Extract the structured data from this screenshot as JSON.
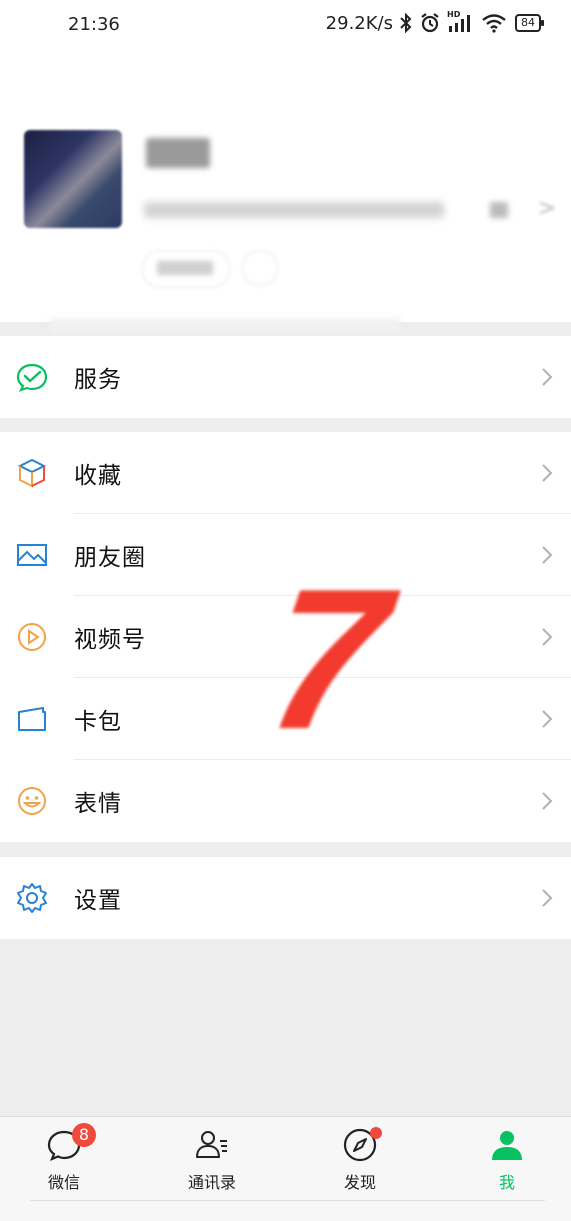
{
  "status_bar": {
    "time": "21:36",
    "net_speed": "29.2K/s",
    "hd_label": "HD",
    "battery": "84"
  },
  "profile": {
    "nickname_blurred": true,
    "wxid_blurred": true
  },
  "menu": {
    "service": {
      "label": "服务",
      "icon": "wechat-pay-icon",
      "color": "#07c160"
    },
    "favorites": {
      "label": "收藏",
      "icon": "cube-icon"
    },
    "moments": {
      "label": "朋友圈",
      "icon": "picture-icon",
      "color": "#2782d7"
    },
    "channels": {
      "label": "视频号",
      "icon": "play-circle-icon",
      "color": "#f0a34a"
    },
    "cards": {
      "label": "卡包",
      "icon": "card-icon",
      "color": "#2782d7"
    },
    "stickers": {
      "label": "表情",
      "icon": "smile-icon",
      "color": "#f0a34a"
    },
    "settings": {
      "label": "设置",
      "icon": "gear-icon",
      "color": "#2782d7"
    }
  },
  "overlay_number": "7",
  "tabbar": {
    "chats": {
      "label": "微信",
      "badge": "8"
    },
    "contacts": {
      "label": "通讯录"
    },
    "discover": {
      "label": "发现"
    },
    "me": {
      "label": "我"
    },
    "active_color": "#07c160",
    "badge_color": "#f2493f"
  }
}
